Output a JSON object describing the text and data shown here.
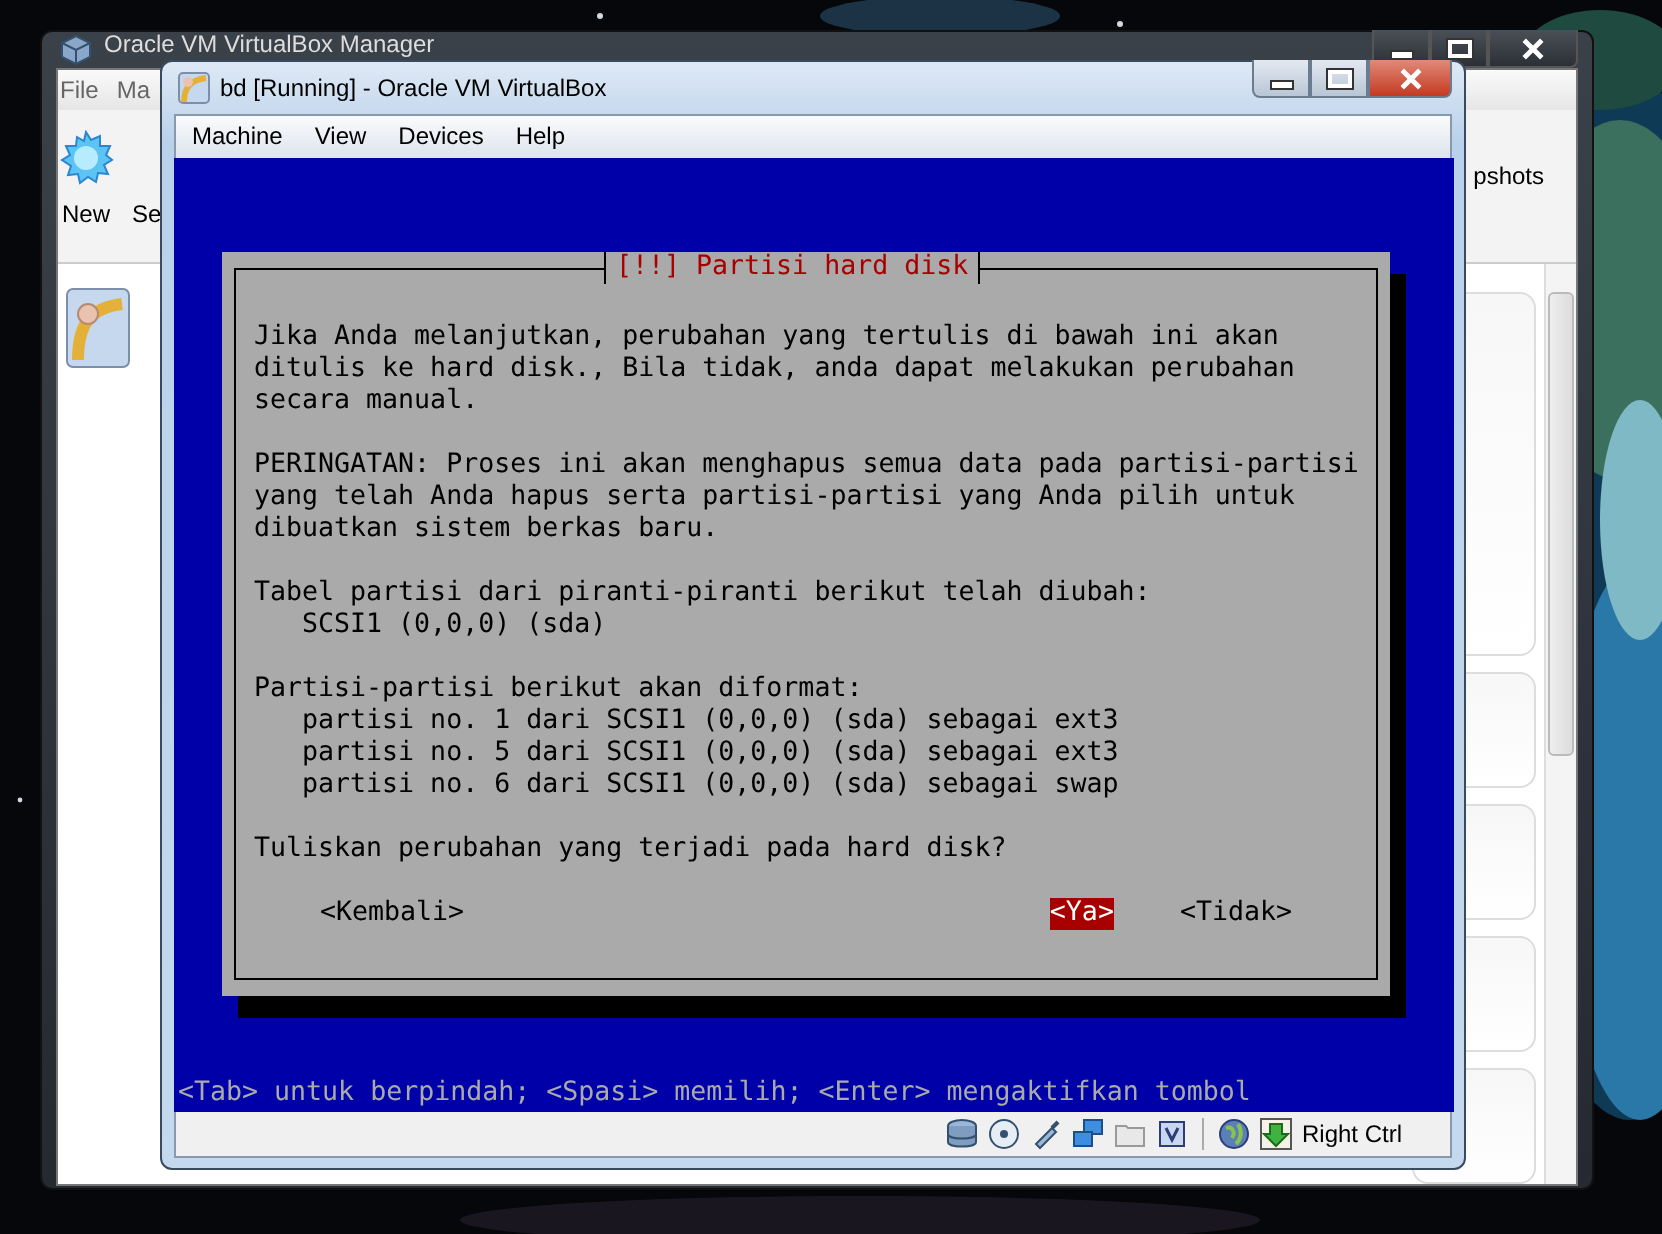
{
  "manager_window": {
    "title": "Oracle VM VirtualBox Manager",
    "menu": [
      "File",
      "Ma"
    ],
    "toolbar": [
      "New",
      "Se"
    ],
    "toolbar_right_label": "pshots"
  },
  "vm_window": {
    "title": "bd [Running] - Oracle VM VirtualBox",
    "menu": [
      "Machine",
      "View",
      "Devices",
      "Help"
    ],
    "dialog": {
      "title": "[!!] Partisi hard disk",
      "paragraphs": [
        [
          "Jika Anda melanjutkan, perubahan yang tertulis di bawah ini akan",
          "ditulis ke hard disk., Bila tidak, anda dapat melakukan perubahan",
          "secara manual."
        ],
        [
          "PERINGATAN: Proses ini akan menghapus semua data pada partisi-partisi",
          "yang telah Anda hapus serta partisi-partisi yang Anda pilih untuk",
          "dibuatkan sistem berkas baru."
        ],
        [
          "Tabel partisi dari piranti-piranti berikut telah diubah:",
          "   SCSI1 (0,0,0) (sda)"
        ],
        [
          "Partisi-partisi berikut akan diformat:",
          "   partisi no. 1 dari SCSI1 (0,0,0) (sda) sebagai ext3",
          "   partisi no. 5 dari SCSI1 (0,0,0) (sda) sebagai ext3",
          "   partisi no. 6 dari SCSI1 (0,0,0) (sda) sebagai swap"
        ],
        [
          "Tuliskan perubahan yang terjadi pada hard disk?"
        ]
      ],
      "buttons": [
        {
          "label": "<Kembali>",
          "selected": false
        },
        {
          "label": "<Ya>",
          "selected": true
        },
        {
          "label": "<Tidak>",
          "selected": false
        }
      ]
    },
    "hint": "<Tab> untuk berpindah; <Spasi> memilih; <Enter> mengaktifkan tombol",
    "status_bar": {
      "host_key": "Right Ctrl"
    }
  }
}
